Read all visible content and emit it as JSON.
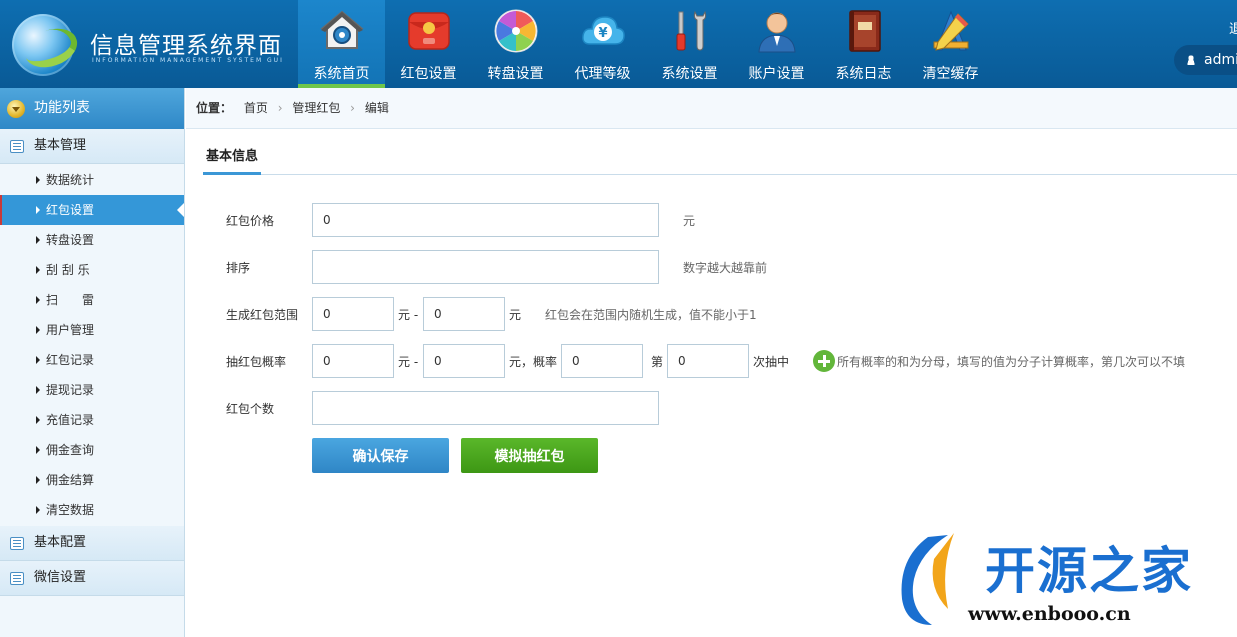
{
  "app": {
    "title": "信息管理系统界面",
    "subtitle": "INFORMATION MANAGEMENT SYSTEM GUI"
  },
  "nav": [
    {
      "label": "系统首页",
      "icon": "home-icon",
      "active": true
    },
    {
      "label": "红包设置",
      "icon": "red-envelope-icon",
      "active": false
    },
    {
      "label": "转盘设置",
      "icon": "color-wheel-icon",
      "active": false
    },
    {
      "label": "代理等级",
      "icon": "yen-cloud-icon",
      "active": false
    },
    {
      "label": "系统设置",
      "icon": "tools-icon",
      "active": false
    },
    {
      "label": "账户设置",
      "icon": "user-account-icon",
      "active": false
    },
    {
      "label": "系统日志",
      "icon": "book-icon",
      "active": false
    },
    {
      "label": "清空缓存",
      "icon": "ruler-pencil-icon",
      "active": false
    }
  ],
  "user": {
    "top_text": "退",
    "name": "admin"
  },
  "sidebar": {
    "header": "功能列表",
    "groups": [
      {
        "label": "基本管理"
      },
      {
        "label": "基本配置"
      },
      {
        "label": "微信设置"
      }
    ],
    "items": [
      {
        "label": "数据统计"
      },
      {
        "label": "红包设置",
        "active": true
      },
      {
        "label": "转盘设置"
      },
      {
        "label": "刮 刮 乐"
      },
      {
        "label": "扫　　雷"
      },
      {
        "label": "用户管理"
      },
      {
        "label": "红包记录"
      },
      {
        "label": "提现记录"
      },
      {
        "label": "充值记录"
      },
      {
        "label": "佣金查询"
      },
      {
        "label": "佣金结算"
      },
      {
        "label": "清空数据"
      }
    ]
  },
  "breadcrumb": {
    "prefix": "位置：",
    "items": [
      "首页",
      "管理红包",
      "编辑"
    ]
  },
  "section_tab": "基本信息",
  "form": {
    "price": {
      "label": "红包价格",
      "value": "0",
      "unit": "元"
    },
    "sort": {
      "label": "排序",
      "value": "",
      "hint": "数字越大越靠前"
    },
    "range": {
      "label": "生成红包范围",
      "min": "0",
      "dash": "元 -",
      "max": "0",
      "unit": "元",
      "hint": "红包会在范围内随机生成，值不能小于1"
    },
    "prob": {
      "label": "抽红包概率",
      "min": "0",
      "dash": "元 -",
      "max": "0",
      "mid": "元，概率",
      "rate": "0",
      "nth_prefix": "第",
      "nth": "0",
      "nth_suffix": "次抽中",
      "hint": "所有概率的和为分母，填写的值为分子计算概率，第几次可以不填"
    },
    "count": {
      "label": "红包个数",
      "value": ""
    }
  },
  "buttons": {
    "save": "确认保存",
    "simulate": "模拟抽红包"
  },
  "watermark": {
    "brand": "开源之家",
    "url": "www.enbooo.cn"
  }
}
